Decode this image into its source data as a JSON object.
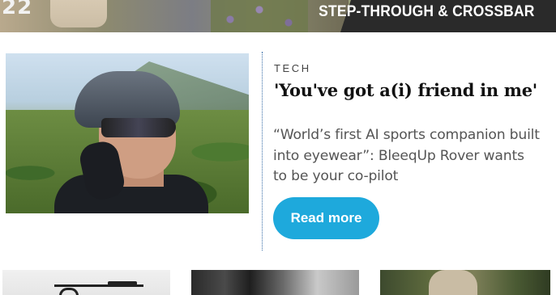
{
  "banner": {
    "badge_number": "22",
    "text": "STEP-THROUGH & CROSSBAR"
  },
  "article": {
    "category": "TECH",
    "headline": "'You've got a(i) friend in me'",
    "summary": "“World’s first AI sports companion built into eyewear”: BleeqUp Rover wants to be your co-pilot",
    "button_label": "Read more",
    "accent_color": "#1ea9dc"
  },
  "thumbnails": [
    {
      "subject": "bike"
    },
    {
      "subject": "dark-photo"
    },
    {
      "subject": "rider-in-forest"
    }
  ]
}
